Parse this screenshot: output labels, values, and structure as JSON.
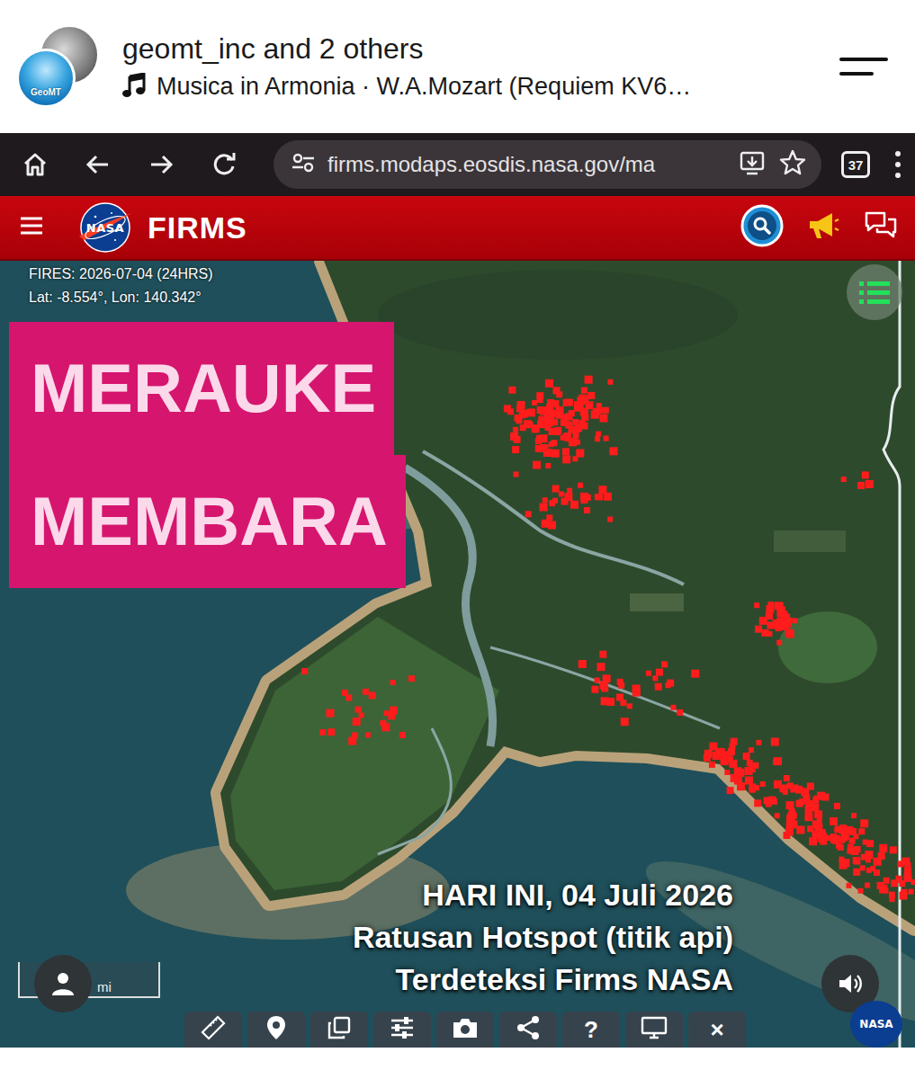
{
  "post_header": {
    "avatar_label": "GeoMT",
    "account": "geomt_inc and 2 others",
    "music": "Musica in Armonia · W.A.Mozart (Requiem KV6…"
  },
  "browser": {
    "url": "firms.modaps.eosdis.nasa.gov/ma",
    "tab_count": "37"
  },
  "app_bar": {
    "logo": "NASA",
    "title": "FIRMS"
  },
  "map": {
    "fires_label": "FIRES: 2026-07-04 (24HRS)",
    "coords": "Lat: -8.554°, Lon: 140.342°",
    "scale_unit": "mi",
    "badge": "NASA"
  },
  "headline": [
    "MERAUKE",
    "MEMBARA"
  ],
  "caption": [
    "HARI INI, 04 Juli 2026",
    "Ratusan Hotspot (titik api)",
    "Terdeteksi Firms NASA"
  ],
  "toolbar": {
    "items": [
      {
        "kind": "icon"
      },
      {
        "kind": "icon"
      },
      {
        "kind": "icon"
      },
      {
        "kind": "icon"
      },
      {
        "kind": "icon"
      },
      {
        "kind": "icon"
      },
      {
        "kind": "glyph",
        "text": "?"
      },
      {
        "kind": "icon"
      },
      {
        "kind": "glyph",
        "text": "×"
      }
    ]
  }
}
